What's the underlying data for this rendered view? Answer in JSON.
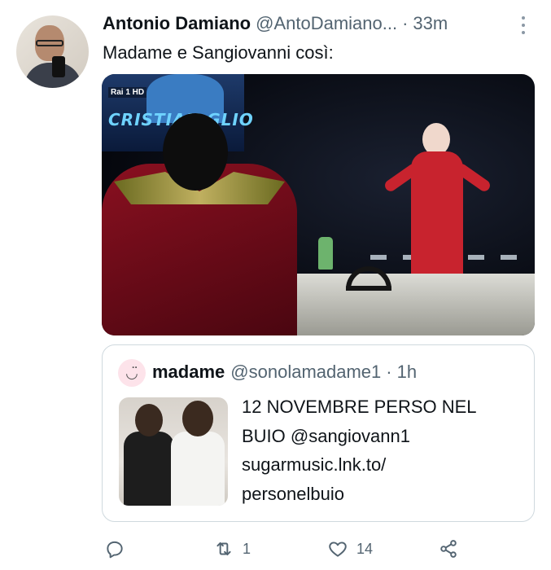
{
  "tweet": {
    "author_name": "Antonio Damiano",
    "handle": "@AntoDamiano...",
    "separator": "·",
    "time": "33m",
    "text": "Madame e Sangiovanni così:"
  },
  "media": {
    "channel_logo": "Rai 1 HD",
    "banner_text": "CRISTIAN    GLIO"
  },
  "quoted": {
    "avatar_emoji": "◡̈",
    "author_name": "madame",
    "handle": "@sonolamadame1",
    "separator": "·",
    "time": "1h",
    "lines": [
      "12 NOVEMBRE PERSO NEL",
      "BUIO @sangiovann1",
      "sugarmusic.lnk.to/",
      "personelbuio"
    ]
  },
  "actions": {
    "reply_icon": "reply-icon",
    "retweet_icon": "retweet-icon",
    "retweet_count": "1",
    "like_icon": "heart-icon",
    "like_count": "14",
    "share_icon": "share-icon"
  },
  "colors": {
    "text_primary": "#0f1419",
    "text_secondary": "#536471",
    "border": "#cfd9de"
  }
}
